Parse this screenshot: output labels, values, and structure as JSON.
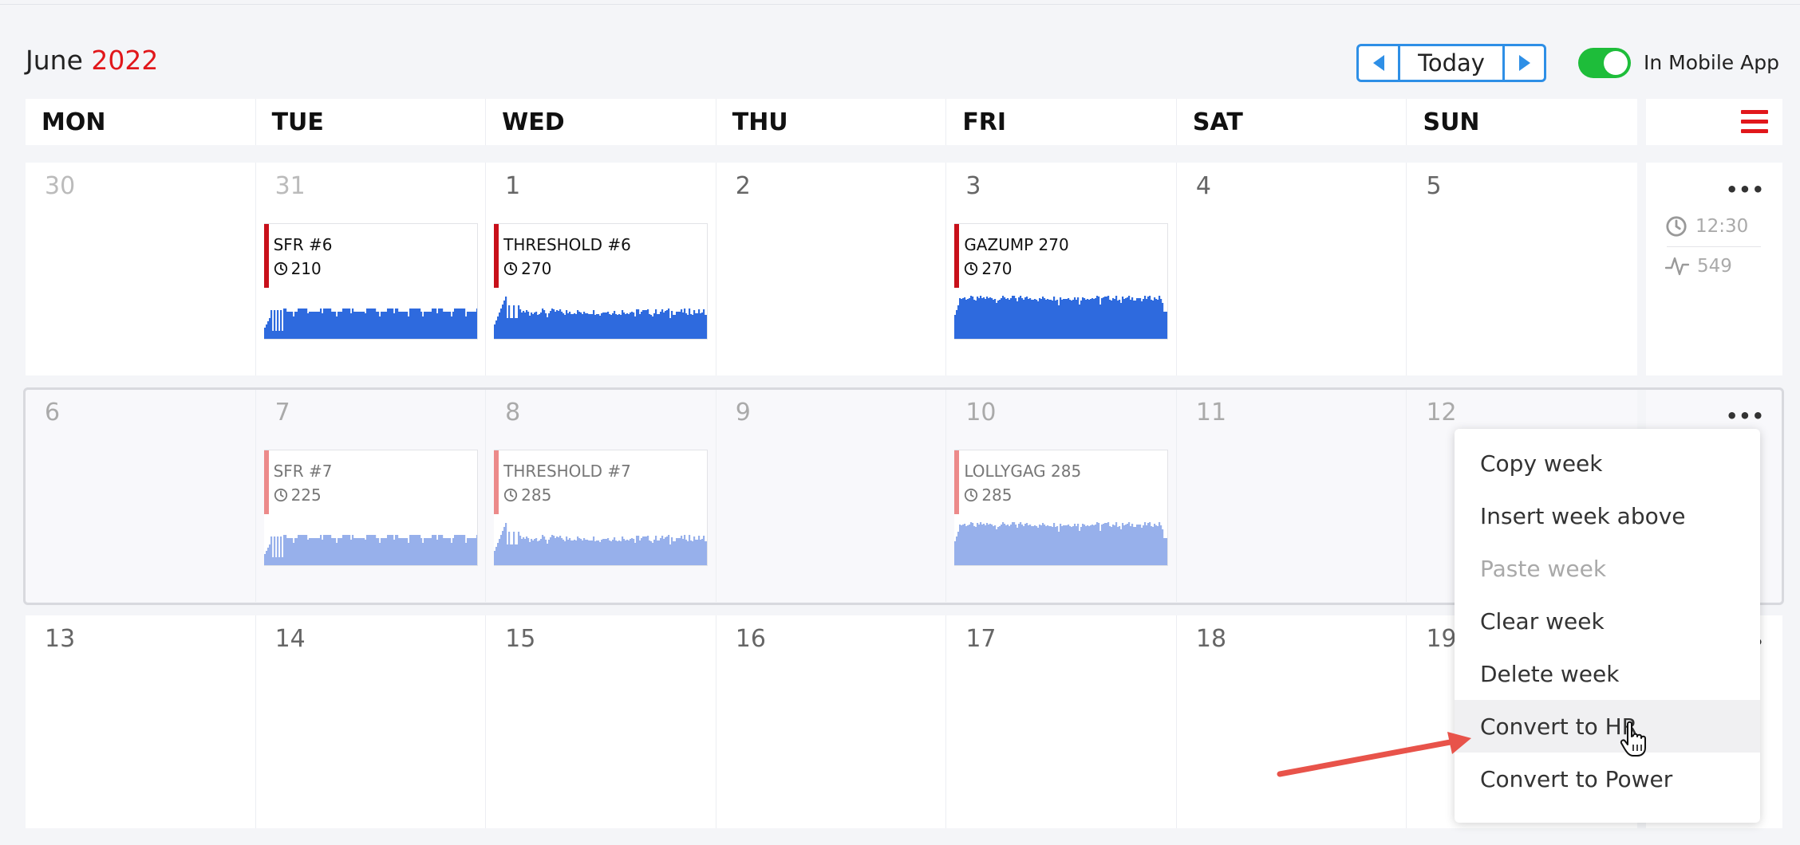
{
  "header": {
    "month": "June",
    "year": "2022",
    "today_label": "Today",
    "mobile_label": "In Mobile App",
    "mobile_enabled": true
  },
  "weekdays": [
    "MON",
    "TUE",
    "WED",
    "THU",
    "FRI",
    "SAT",
    "SUN"
  ],
  "weeks": [
    {
      "days": [
        "30",
        "31",
        "1",
        "2",
        "3",
        "4",
        "5"
      ],
      "faded": [
        true,
        true,
        false,
        false,
        false,
        false,
        false
      ],
      "summary": {
        "duration": "12:30",
        "load": "549"
      },
      "workouts": [
        {
          "day_index": 1,
          "name": "SFR #6",
          "value": "210",
          "profile": "sfr"
        },
        {
          "day_index": 2,
          "name": "THRESHOLD #6",
          "value": "270",
          "profile": "threshold"
        },
        {
          "day_index": 4,
          "name": "GAZUMP 270",
          "value": "270",
          "profile": "gazump"
        }
      ]
    },
    {
      "days": [
        "6",
        "7",
        "8",
        "9",
        "10",
        "11",
        "12"
      ],
      "faded": [
        true,
        true,
        true,
        true,
        true,
        true,
        true
      ],
      "selected": true,
      "workouts": [
        {
          "day_index": 1,
          "name": "SFR #7",
          "value": "225",
          "profile": "sfr"
        },
        {
          "day_index": 2,
          "name": "THRESHOLD #7",
          "value": "285",
          "profile": "threshold"
        },
        {
          "day_index": 4,
          "name": "LOLLYGAG 285",
          "value": "285",
          "profile": "gazump"
        }
      ]
    },
    {
      "days": [
        "13",
        "14",
        "15",
        "16",
        "17",
        "18",
        "19"
      ],
      "faded": [
        false,
        false,
        false,
        false,
        false,
        false,
        false
      ],
      "workouts": []
    }
  ],
  "context_menu": {
    "items": [
      {
        "label": "Copy week",
        "disabled": false
      },
      {
        "label": "Insert week above",
        "disabled": false
      },
      {
        "label": "Paste week",
        "disabled": true
      },
      {
        "label": "Clear week",
        "disabled": false
      },
      {
        "label": "Delete week",
        "disabled": false
      },
      {
        "label": "Convert to HR",
        "disabled": false,
        "hover": true
      },
      {
        "label": "Convert to Power",
        "disabled": false
      }
    ]
  },
  "colors": {
    "accent_red": "#e1171b",
    "nav_blue": "#2e8fe6",
    "toggle_green": "#1ebd3a",
    "graph_blue": "#2e6ade",
    "graph_blue_faded": "#97b0eb",
    "annotation_arrow": "#e8534a"
  }
}
